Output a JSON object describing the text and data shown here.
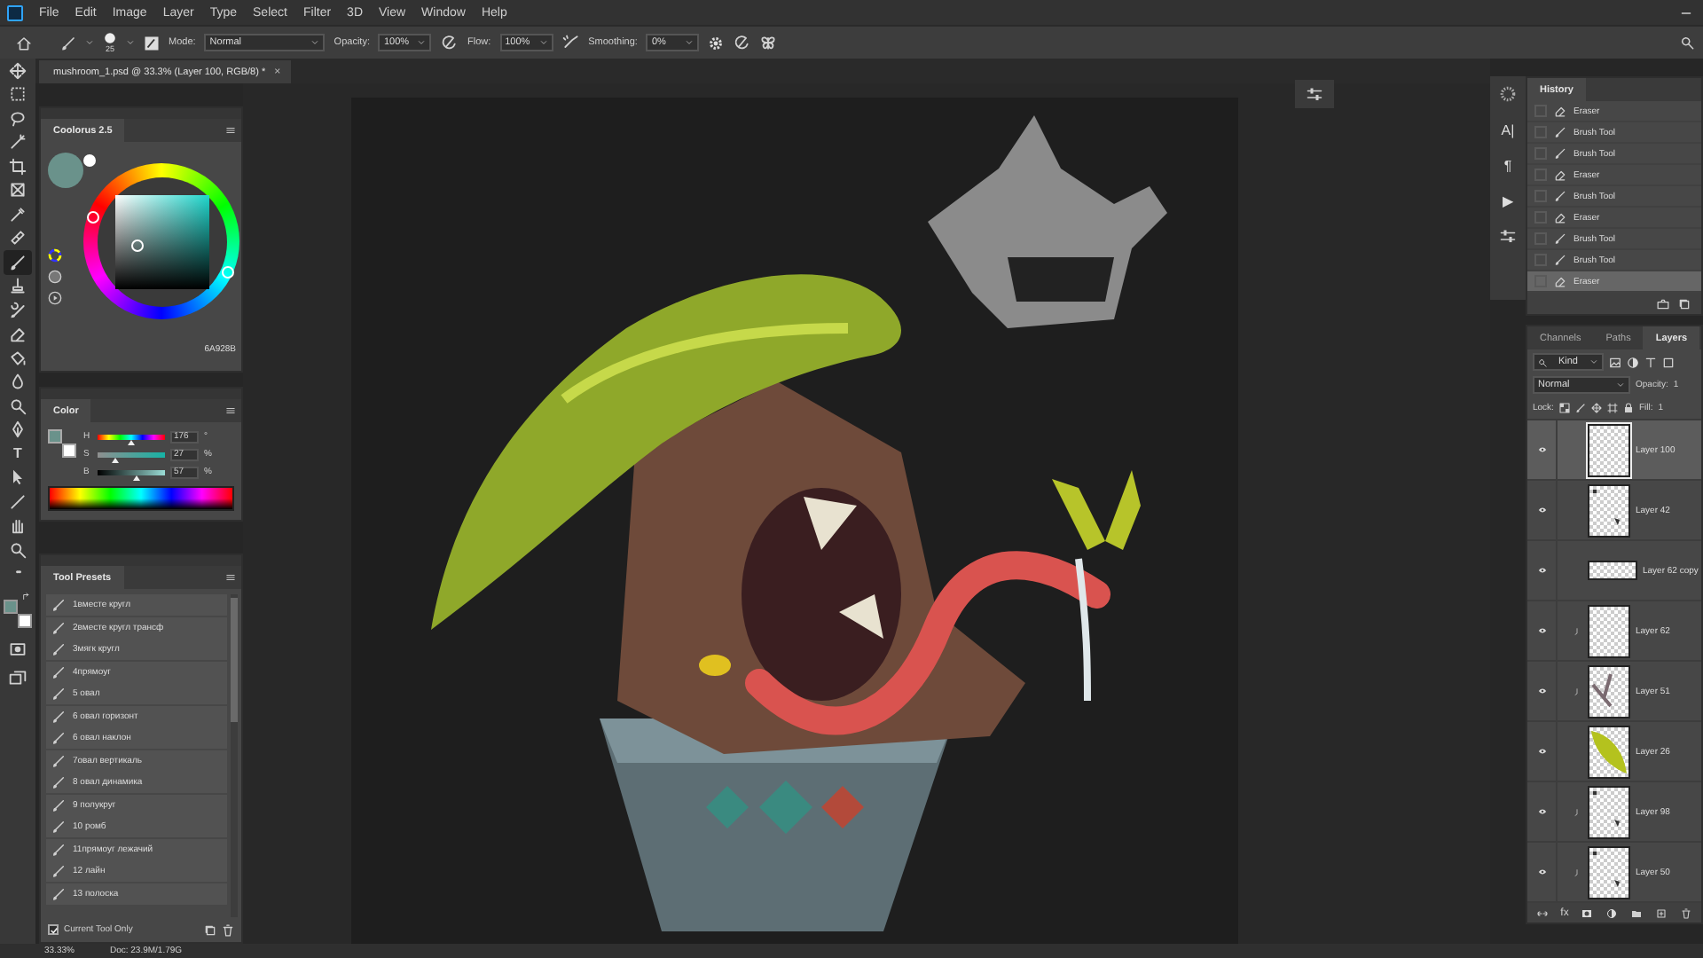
{
  "menu_bar": {
    "items": [
      "File",
      "Edit",
      "Image",
      "Layer",
      "Type",
      "Select",
      "Filter",
      "3D",
      "View",
      "Window",
      "Help"
    ]
  },
  "options_bar": {
    "brush_size": "25",
    "mode_label": "Mode:",
    "mode": "Normal",
    "opacity_label": "Opacity:",
    "opacity": "100%",
    "flow_label": "Flow:",
    "flow": "100%",
    "smoothing_label": "Smoothing:",
    "smoothing": "0%"
  },
  "document_tab": {
    "title": "mushroom_1.psd @ 33.3% (Layer 100, RGB/8) *",
    "close": "×"
  },
  "tools": [
    {
      "kind": "move",
      "selected": false
    },
    {
      "kind": "marquee",
      "selected": false
    },
    {
      "kind": "lasso",
      "selected": false
    },
    {
      "kind": "wand",
      "selected": false
    },
    {
      "kind": "crop",
      "selected": false
    },
    {
      "kind": "frame",
      "selected": false
    },
    {
      "kind": "eyedropper",
      "selected": false
    },
    {
      "kind": "bandage",
      "selected": false
    },
    {
      "kind": "brush",
      "selected": true
    },
    {
      "kind": "stamp",
      "selected": false
    },
    {
      "kind": "history-brush",
      "selected": false
    },
    {
      "kind": "eraser",
      "selected": false
    },
    {
      "kind": "bucket",
      "selected": false
    },
    {
      "kind": "drop",
      "selected": false
    },
    {
      "kind": "dodge",
      "selected": false
    },
    {
      "kind": "pen",
      "selected": false
    },
    {
      "kind": "type",
      "text": "T",
      "selected": false
    },
    {
      "kind": "path-select",
      "selected": false
    },
    {
      "kind": "line",
      "selected": false
    },
    {
      "kind": "hand",
      "selected": false
    },
    {
      "kind": "zoom",
      "selected": false
    },
    {
      "kind": "more",
      "text": "•••",
      "selected": false
    }
  ],
  "color_swatches": [
    {
      "kind": "foreground",
      "color": "#6a928b"
    },
    {
      "kind": "background",
      "color": "#ffffff"
    }
  ],
  "mode_tools": [
    {
      "kind": "quick-mask",
      "selected": false
    },
    {
      "kind": "screen-mode",
      "selected": false
    }
  ],
  "coolorus": {
    "title": "Coolorus 2.5",
    "hex": "6A928B",
    "swatches": [
      {
        "kind": "current",
        "color": "#6a928b"
      },
      {
        "kind": "previous",
        "color": "#ffffff"
      }
    ]
  },
  "color_panel": {
    "title": "Color",
    "swatches": [
      {
        "kind": "foreground",
        "color": "#6a928b"
      },
      {
        "kind": "background",
        "color": "#ffffff"
      }
    ],
    "sliders": [
      {
        "kind": "hue",
        "label": "H",
        "level": 0.49,
        "value": "176",
        "unit": "°"
      },
      {
        "kind": "saturation",
        "label": "S",
        "level": 0.27,
        "value": "27",
        "unit": "%"
      },
      {
        "kind": "brightness",
        "label": "B",
        "level": 0.57,
        "value": "57",
        "unit": "%"
      }
    ]
  },
  "tool_presets": {
    "title": "Tool Presets",
    "items": [
      {
        "label": "1вместе кругл",
        "selected": false
      },
      {
        "label": "2вместе кругл трансф",
        "selected": false
      },
      {
        "label": "3мягк кругл",
        "selected": false
      },
      {
        "label": "4прямоуг",
        "selected": false
      },
      {
        "label": "5 овал",
        "selected": false
      },
      {
        "label": "6 овал горизонт",
        "selected": false
      },
      {
        "label": "6 овал наклон",
        "selected": false
      },
      {
        "label": "7овал вертикаль",
        "selected": false
      },
      {
        "label": "8 овал динамика",
        "selected": false
      },
      {
        "label": "9 полукруг",
        "selected": false
      },
      {
        "label": "10 ромб",
        "selected": false
      },
      {
        "label": "11прямоуг лежачий",
        "selected": false
      },
      {
        "label": "12 лайн",
        "selected": false
      },
      {
        "label": "13 полоска",
        "selected": false
      }
    ],
    "current_tool_only": {
      "label": "Current Tool Only",
      "checked": true
    }
  },
  "dock_icons": [
    {
      "kind": "brush-settings"
    },
    {
      "kind": "glyph",
      "text": "A|"
    },
    {
      "kind": "glyph",
      "text": "¶"
    },
    {
      "kind": "glyph",
      "text": "▶"
    },
    {
      "kind": "properties"
    }
  ],
  "history": {
    "title": "History",
    "items": [
      {
        "kind": "eraser",
        "label": "Eraser",
        "selected": false
      },
      {
        "kind": "brush",
        "label": "Brush Tool",
        "selected": false
      },
      {
        "kind": "brush",
        "label": "Brush Tool",
        "selected": false
      },
      {
        "kind": "eraser",
        "label": "Eraser",
        "selected": false
      },
      {
        "kind": "brush",
        "label": "Brush Tool",
        "selected": false
      },
      {
        "kind": "eraser",
        "label": "Eraser",
        "selected": false
      },
      {
        "kind": "brush",
        "label": "Brush Tool",
        "selected": false
      },
      {
        "kind": "brush",
        "label": "Brush Tool",
        "selected": false
      },
      {
        "kind": "eraser",
        "label": "Eraser",
        "selected": true
      }
    ]
  },
  "layers_panel": {
    "tabs": [
      {
        "label": "Channels",
        "selected": false
      },
      {
        "label": "Paths",
        "selected": false
      },
      {
        "label": "Layers",
        "selected": true
      }
    ],
    "filter": "Kind",
    "blend_mode": "Normal",
    "opacity_label": "Opacity:",
    "opacity": "1",
    "lock_label": "Lock:",
    "fill_label": "Fill:",
    "fill": "1",
    "layers": [
      {
        "name": "Layer 100",
        "visible": true,
        "clipped": false,
        "kind": "blank",
        "selected": true
      },
      {
        "name": "Layer 42",
        "visible": true,
        "clipped": false,
        "kind": "sparse",
        "selected": false
      },
      {
        "name": "Layer 62 copy",
        "visible": true,
        "clipped": false,
        "kind": "strip",
        "selected": false
      },
      {
        "name": "Layer 62",
        "visible": true,
        "clipped": true,
        "kind": "blank",
        "selected": false
      },
      {
        "name": "Layer 51",
        "visible": true,
        "clipped": true,
        "kind": "strokes",
        "selected": false
      },
      {
        "name": "Layer 26",
        "visible": true,
        "clipped": false,
        "kind": "leaf",
        "selected": false
      },
      {
        "name": "Layer 98",
        "visible": true,
        "clipped": true,
        "kind": "sparse",
        "selected": false
      },
      {
        "name": "Layer 50",
        "visible": true,
        "clipped": true,
        "kind": "sparse",
        "selected": false
      }
    ],
    "fx_label": "fx"
  },
  "status_bar": {
    "zoom": "33.33%",
    "doc": "Doc: 23.9M/1.79G"
  }
}
